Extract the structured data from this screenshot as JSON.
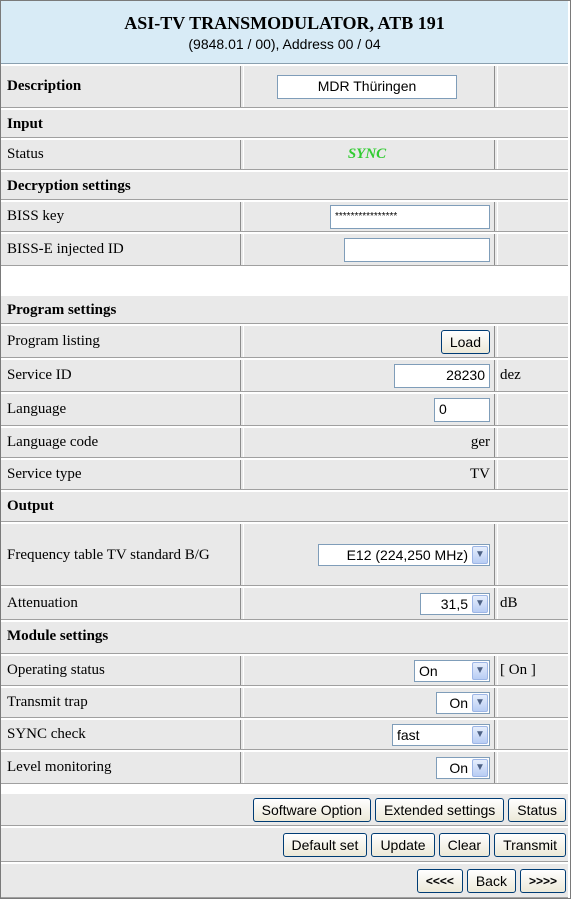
{
  "header": {
    "title": "ASI-TV TRANSMODULATOR, ATB 191",
    "subtitle": "(9848.01 / 00), Address 00 / 04"
  },
  "description": {
    "label": "Description",
    "value": "MDR Thüringen"
  },
  "input": {
    "section": "Input",
    "status_label": "Status",
    "status_value": "SYNC",
    "status_color": "#33cc33"
  },
  "decryption": {
    "section": "Decryption settings",
    "biss_key_label": "BISS key",
    "biss_key_value": "****************",
    "biss_e_label": "BISS-E injected ID",
    "biss_e_value": ""
  },
  "program": {
    "section": "Program settings",
    "listing_label": "Program listing",
    "load_button": "Load",
    "service_id_label": "Service ID",
    "service_id_value": "28230",
    "service_id_unit": "dez",
    "language_label": "Language",
    "language_value": "0",
    "language_code_label": "Language code",
    "language_code_value": "ger",
    "service_type_label": "Service type",
    "service_type_value": "TV"
  },
  "output": {
    "section": "Output",
    "freq_label": "Frequency table TV standard B/G",
    "freq_value": "E12 (224,250 MHz)",
    "attenuation_label": "Attenuation",
    "attenuation_value": "31,5",
    "attenuation_unit": "dB"
  },
  "module": {
    "section": "Module settings",
    "operating_label": "Operating status",
    "operating_value": "On",
    "operating_status": "[ On ]",
    "trap_label": "Transmit trap",
    "trap_value": "On",
    "sync_label": "SYNC check",
    "sync_value": "fast",
    "level_label": "Level monitoring",
    "level_value": "On"
  },
  "buttons": {
    "software_option": "Software Option",
    "extended": "Extended settings",
    "status": "Status",
    "default_set": "Default set",
    "update": "Update",
    "clear": "Clear",
    "transmit": "Transmit",
    "prev": "<<<<",
    "back": "Back",
    "next": ">>>>"
  },
  "icons": {
    "dropdown": "chevron-down-icon"
  }
}
